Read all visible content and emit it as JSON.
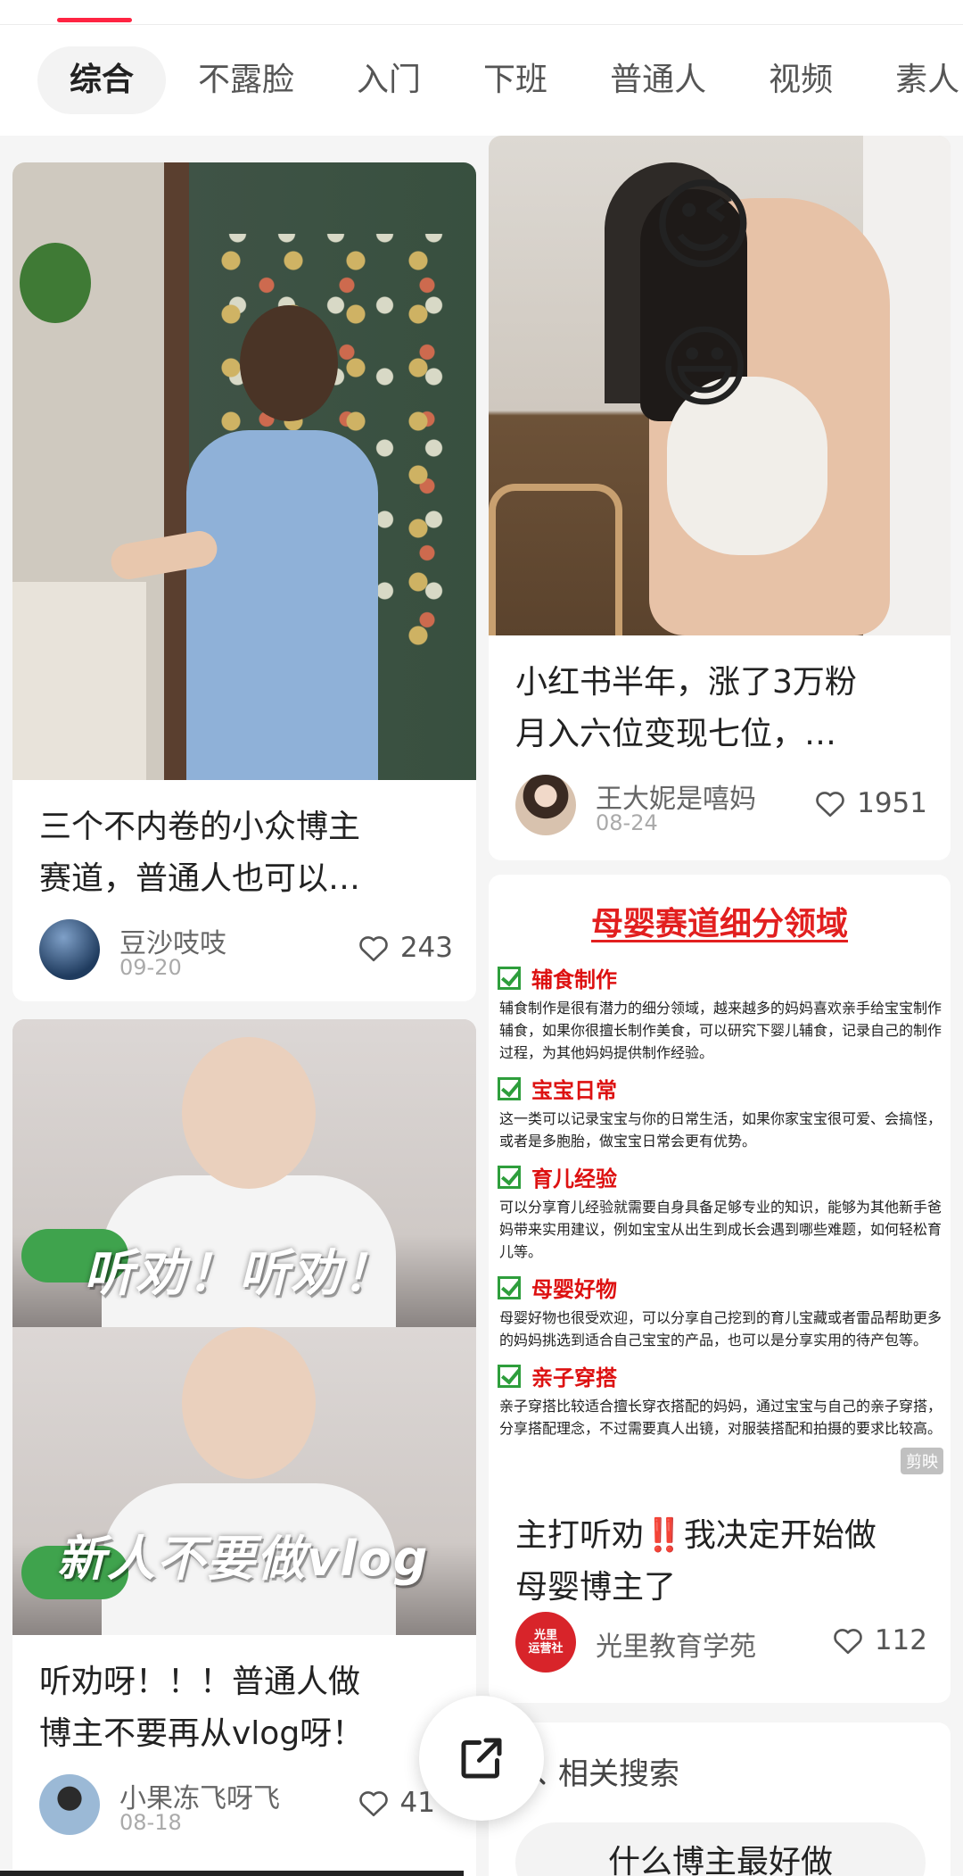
{
  "tabs": [
    {
      "label": "综合",
      "active": true
    },
    {
      "label": "不露脸"
    },
    {
      "label": "入门"
    },
    {
      "label": "下班"
    },
    {
      "label": "普通人"
    },
    {
      "label": "视频"
    },
    {
      "label": "素人"
    }
  ],
  "cards": [
    {
      "title_line1": "三个不内卷的小众博主",
      "title_line2": "赛道，普通人也可以…",
      "author": "豆沙吱吱",
      "date": "09-20",
      "likes": "243"
    },
    {
      "title_line1": "小红书半年，涨了3万粉",
      "title_line2": "月入六位变现七位，…",
      "author": "王大妮是嘻妈",
      "date": "08-24",
      "likes": "1951",
      "emojis": [
        "😉",
        "😃"
      ]
    },
    {
      "overlay_top": "听劝！听劝！",
      "overlay_bottom": "新人不要做vlog",
      "title_line1": "听劝呀！！！普通人做",
      "title_line2": "博主不要再从vlog呀！",
      "author": "小果冻飞呀飞",
      "date": "08-18",
      "likes": "41"
    },
    {
      "title_line1": "主打听劝‼️我决定开始做",
      "title_line2": "母婴博主了",
      "author": "光里教育学苑",
      "avatar_text": "光里\n运营社",
      "likes": "112"
    }
  ],
  "infographic": {
    "title": "母婴赛道细分领域",
    "sections": [
      {
        "head": "辅食制作",
        "body": "辅食制作是很有潜力的细分领域，越来越多的妈妈喜欢亲手给宝宝制作辅食，如果你很擅长制作美食，可以研究下婴儿辅食，记录自己的制作过程，为其他妈妈提供制作经验。"
      },
      {
        "head": "宝宝日常",
        "body": "这一类可以记录宝宝与你的日常生活，如果你家宝宝很可爱、会搞怪，或者是多胞胎，做宝宝日常会更有优势。"
      },
      {
        "head": "育儿经验",
        "body": "可以分享育儿经验就需要自身具备足够专业的知识，能够为其他新手爸妈带来实用建议，例如宝宝从出生到成长会遇到哪些难题，如何轻松育儿等。"
      },
      {
        "head": "母婴好物",
        "body": "母婴好物也很受欢迎，可以分享自己挖到的育儿宝藏或者雷品帮助更多的妈妈挑选到适合自己宝宝的产品，也可以是分享实用的待产包等。"
      },
      {
        "head": "亲子穿搭",
        "body": "亲子穿搭比较适合擅长穿衣搭配的妈妈，通过宝宝与自己的亲子穿搭，分享搭配理念，不过需要真人出镜，对服装搭配和拍摄的要求比较高。"
      }
    ],
    "watermark": "剪映"
  },
  "related": {
    "heading": "相关搜索",
    "chip": "什么博主最好做"
  },
  "colors": {
    "accent": "#ff2442",
    "check_green": "#2e9e3c",
    "info_red": "#e21f1f"
  },
  "icons": {
    "like": "heart-outline-icon",
    "share": "share-arrow-icon",
    "search": "search-icon"
  }
}
